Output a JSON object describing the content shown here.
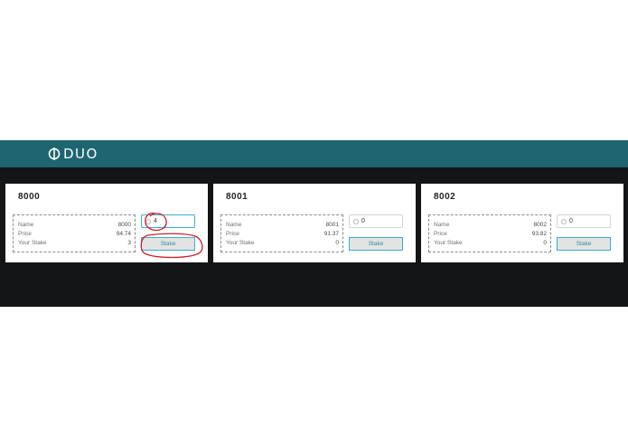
{
  "header": {
    "logo_text": "DUO",
    "color": "#1e6570"
  },
  "labels": {
    "name": "Name",
    "price": "Price",
    "stake": "Your Stake"
  },
  "cards": [
    {
      "title": "8000",
      "name": "8000",
      "price": "94.74",
      "your_stake": "3",
      "input_value": "4",
      "button_label": "Stake"
    },
    {
      "title": "8001",
      "name": "8001",
      "price": "91.37",
      "your_stake": "0",
      "input_value": "0",
      "button_label": "Stake"
    },
    {
      "title": "8002",
      "name": "8002",
      "price": "93.82",
      "your_stake": "0",
      "input_value": "0",
      "button_label": "Stake"
    }
  ],
  "colors": {
    "content_background": "#141516",
    "accent": "#3ab0c8",
    "annotation": "#d0202a"
  }
}
